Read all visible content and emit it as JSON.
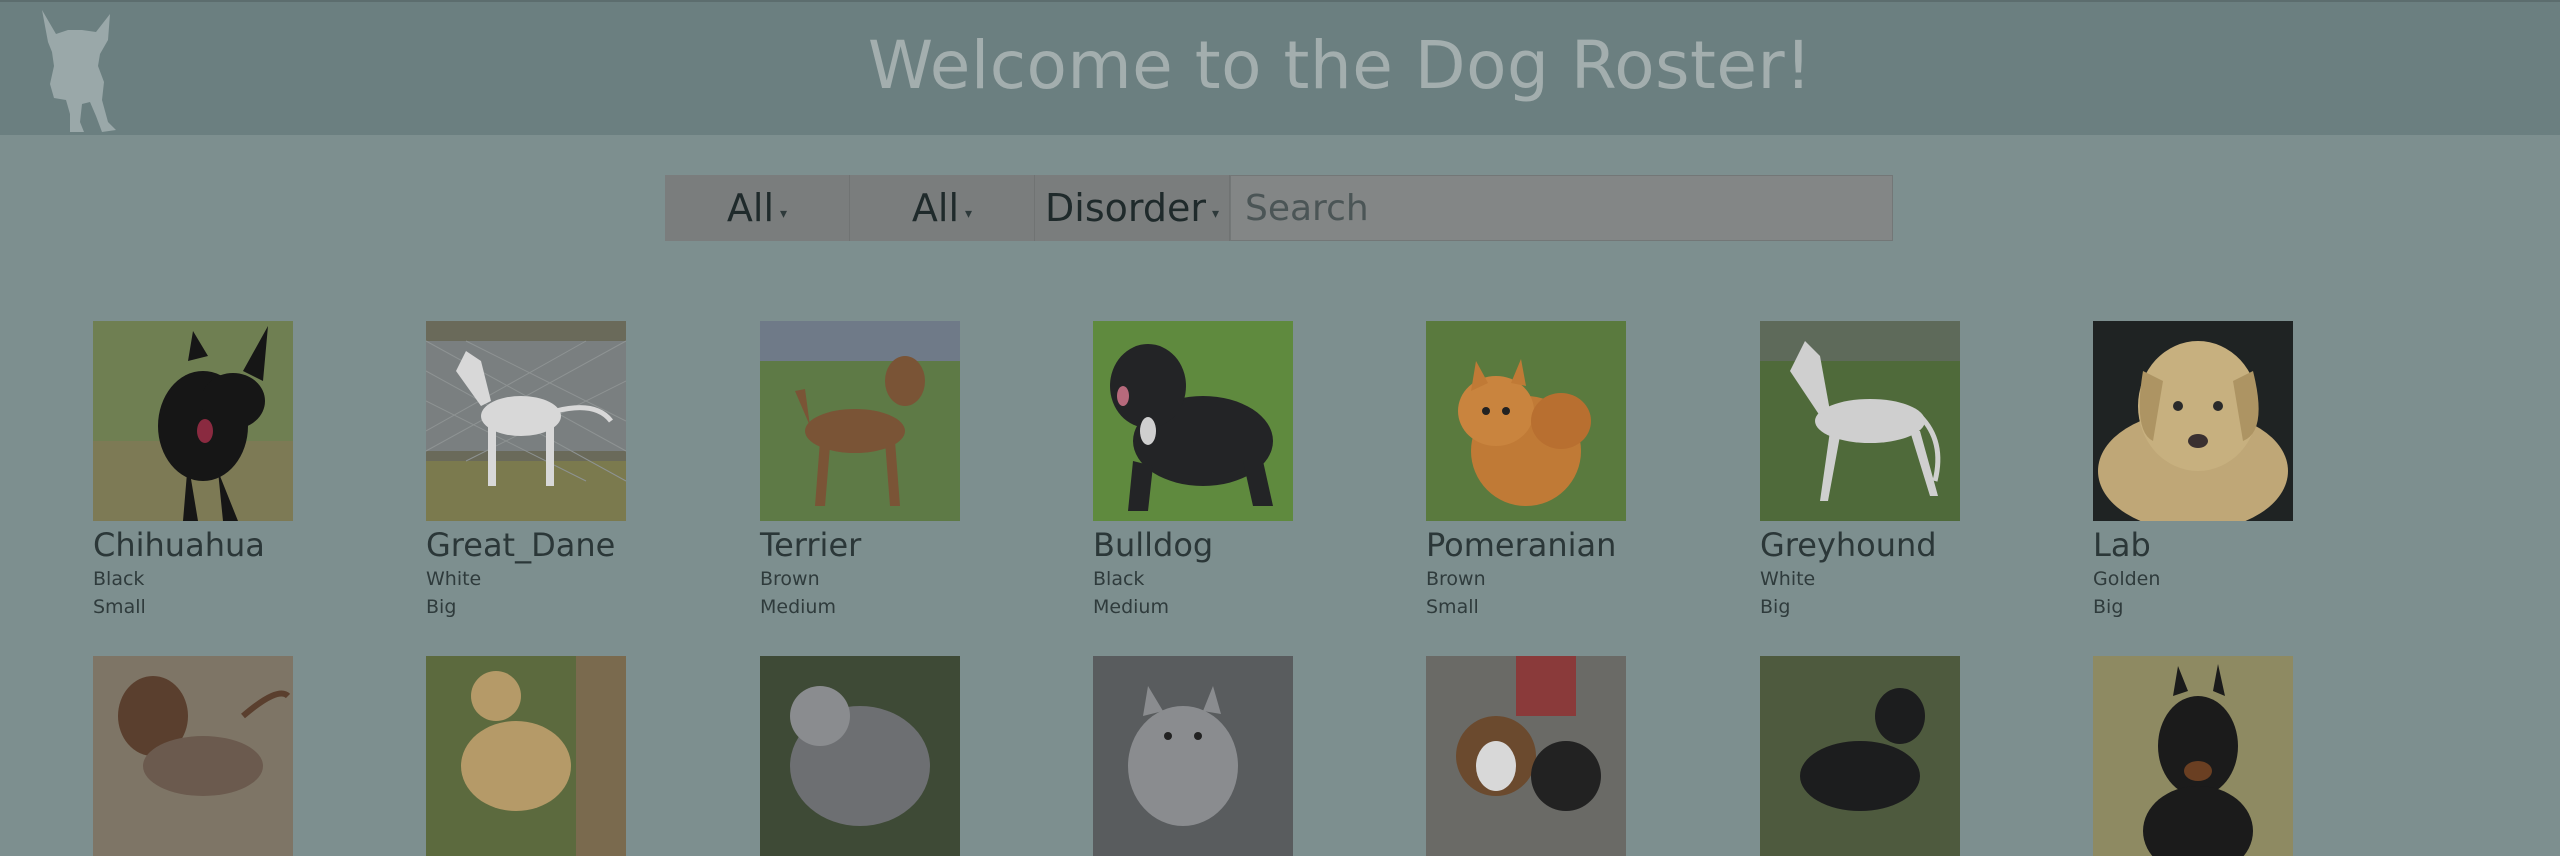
{
  "header": {
    "title": "Welcome to the Dog Roster!",
    "logo_icon": "dog-silhouette-icon"
  },
  "filters": {
    "color_select": "All",
    "size_select": "All",
    "order_select": "Disorder",
    "search_placeholder": "Search"
  },
  "colors": {
    "header_bg": "#6b7f80",
    "page_bg": "#7d8f8f",
    "text_dark": "#2b3738"
  },
  "dogs": [
    {
      "name": "Chihuahua",
      "color": "Black",
      "size": "Small",
      "photo": "chihuahua-photo"
    },
    {
      "name": "Great_Dane",
      "color": "White",
      "size": "Big",
      "photo": "great-dane-photo"
    },
    {
      "name": "Terrier",
      "color": "Brown",
      "size": "Medium",
      "photo": "terrier-photo"
    },
    {
      "name": "Bulldog",
      "color": "Black",
      "size": "Medium",
      "photo": "bulldog-photo"
    },
    {
      "name": "Pomeranian",
      "color": "Brown",
      "size": "Small",
      "photo": "pomeranian-photo"
    },
    {
      "name": "Greyhound",
      "color": "White",
      "size": "Big",
      "photo": "greyhound-photo"
    },
    {
      "name": "Lab",
      "color": "Golden",
      "size": "Big",
      "photo": "lab-photo"
    }
  ],
  "dogs_row2": [
    {
      "photo": "dachshund-photo"
    },
    {
      "photo": "poodle-photo"
    },
    {
      "photo": "wolfdog-photo"
    },
    {
      "photo": "husky-photo"
    },
    {
      "photo": "beagle-photo"
    },
    {
      "photo": "black-dog-photo"
    },
    {
      "photo": "doberman-photo"
    }
  ]
}
